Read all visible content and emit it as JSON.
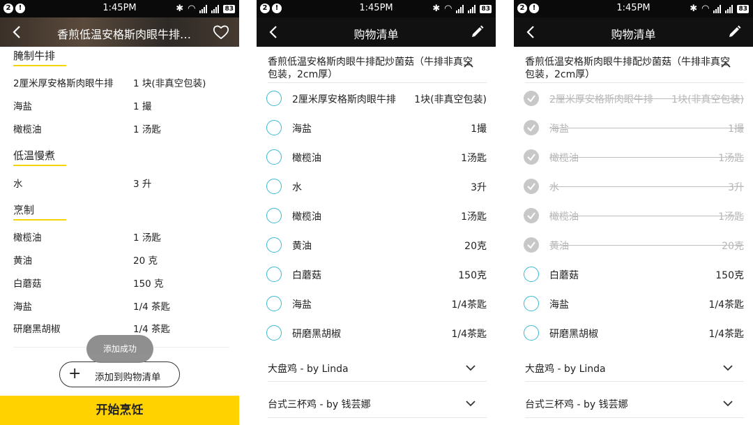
{
  "status": {
    "time": "1:45PM",
    "battery": "83",
    "notif1": "2",
    "notif2": "!"
  },
  "screen1": {
    "title": "香煎低温安格斯肉眼牛排…",
    "sections": [
      {
        "name": "腌制牛排",
        "rows": [
          {
            "name": "2厘米厚安格斯肉眼牛排",
            "qty": "1 块(非真空包装)"
          },
          {
            "name": "海盐",
            "qty": "1 撮"
          },
          {
            "name": "橄榄油",
            "qty": "1 汤匙"
          }
        ]
      },
      {
        "name": "低温慢煮",
        "rows": [
          {
            "name": "水",
            "qty": "3 升"
          }
        ]
      },
      {
        "name": "烹制",
        "rows": [
          {
            "name": "橄榄油",
            "qty": "1 汤匙"
          },
          {
            "name": "黄油",
            "qty": "20 克"
          },
          {
            "name": "白蘑菇",
            "qty": "150 克"
          },
          {
            "name": "海盐",
            "qty": "1/4 茶匙"
          },
          {
            "name": "研磨黑胡椒",
            "qty": "1/4 茶匙"
          }
        ]
      }
    ],
    "toast": "添加成功",
    "add_button": "添加到购物清单",
    "start_button": "开始烹饪"
  },
  "screen2": {
    "title": "购物清单",
    "recipe_title": "香煎低温安格斯肉眼牛排配炒菌菇（牛排非真空包装，2cm厚）",
    "items": [
      {
        "name": "2厘米厚安格斯肉眼牛排",
        "qty": "1块(非真空包装)",
        "checked": false
      },
      {
        "name": "海盐",
        "qty": "1撮",
        "checked": false
      },
      {
        "name": "橄榄油",
        "qty": "1汤匙",
        "checked": false
      },
      {
        "name": "水",
        "qty": "3升",
        "checked": false
      },
      {
        "name": "橄榄油",
        "qty": "1汤匙",
        "checked": false
      },
      {
        "name": "黄油",
        "qty": "20克",
        "checked": false
      },
      {
        "name": "白蘑菇",
        "qty": "150克",
        "checked": false
      },
      {
        "name": "海盐",
        "qty": "1/4茶匙",
        "checked": false
      },
      {
        "name": "研磨黑胡椒",
        "qty": "1/4茶匙",
        "checked": false
      }
    ],
    "other_lists": [
      "大盘鸡 - by Linda",
      "台式三杯鸡 - by 钱芸娜"
    ]
  },
  "screen3": {
    "title": "购物清单",
    "recipe_title": "香煎低温安格斯肉眼牛排配炒菌菇（牛排非真空包装，2cm厚）",
    "items": [
      {
        "name": "2厘米厚安格斯肉眼牛排",
        "qty": "1块(非真空包装)",
        "checked": true
      },
      {
        "name": "海盐",
        "qty": "1撮",
        "checked": true
      },
      {
        "name": "橄榄油",
        "qty": "1汤匙",
        "checked": true
      },
      {
        "name": "水",
        "qty": "3升",
        "checked": true
      },
      {
        "name": "橄榄油",
        "qty": "1汤匙",
        "checked": true
      },
      {
        "name": "黄油",
        "qty": "20克",
        "checked": true
      },
      {
        "name": "白蘑菇",
        "qty": "150克",
        "checked": false
      },
      {
        "name": "海盐",
        "qty": "1/4茶匙",
        "checked": false
      },
      {
        "name": "研磨黑胡椒",
        "qty": "1/4茶匙",
        "checked": false
      }
    ],
    "other_lists": [
      "大盘鸡 - by Linda",
      "台式三杯鸡 - by 钱芸娜"
    ]
  },
  "colors": {
    "accent_yellow": "#ffd200",
    "check_blue": "#3bb8d2",
    "checked_gray": "#c8c8c8"
  }
}
